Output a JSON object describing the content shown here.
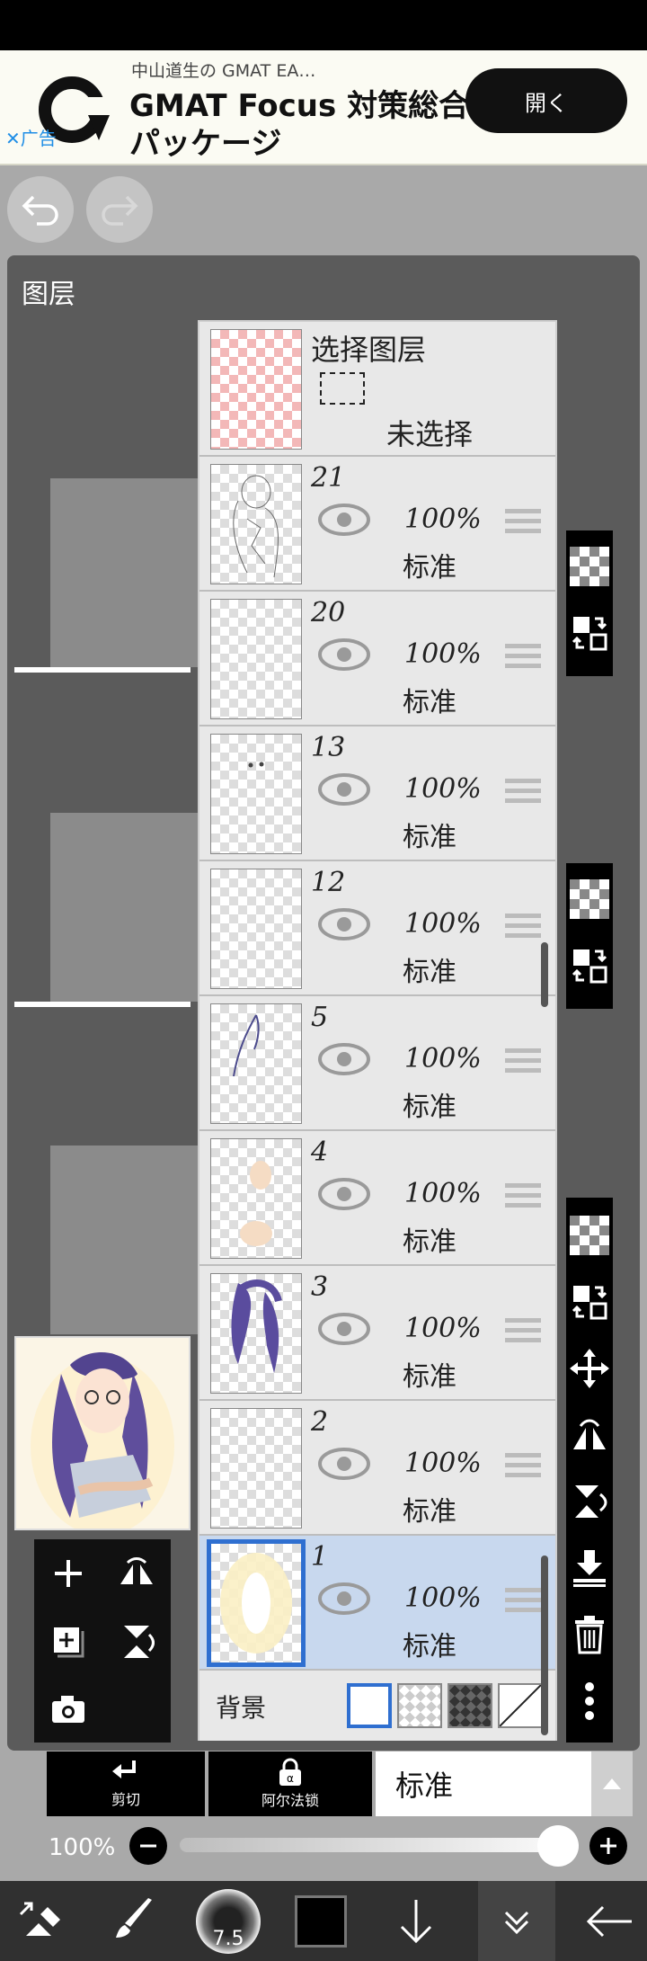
{
  "ad": {
    "small_text": "中山道生の GMAT EA…",
    "title_line1": "GMAT Focus 対策総合",
    "title_line2": "パッケージ",
    "open_label": "開く",
    "ad_tag": "✕广告"
  },
  "panel": {
    "title": "图层"
  },
  "select_layer": {
    "title": "选择图层",
    "status": "未选择"
  },
  "layers": [
    {
      "number": "21",
      "opacity": "100%",
      "blend": "标准"
    },
    {
      "number": "20",
      "opacity": "100%",
      "blend": "标准"
    },
    {
      "number": "13",
      "opacity": "100%",
      "blend": "标准"
    },
    {
      "number": "12",
      "opacity": "100%",
      "blend": "标准"
    },
    {
      "number": "5",
      "opacity": "100%",
      "blend": "标准"
    },
    {
      "number": "4",
      "opacity": "100%",
      "blend": "标准"
    },
    {
      "number": "3",
      "opacity": "100%",
      "blend": "标准"
    },
    {
      "number": "2",
      "opacity": "100%",
      "blend": "标准"
    },
    {
      "number": "1",
      "opacity": "100%",
      "blend": "标准",
      "selected": true
    }
  ],
  "background_row": {
    "label": "背景"
  },
  "bottom_tabs": {
    "clip_label": "剪切",
    "alpha_lock_label": "阿尔法锁",
    "blend_mode": "标准"
  },
  "opacity_control": {
    "label": "100%",
    "value": 1.0
  },
  "brush": {
    "size": "7.5"
  },
  "colors": {
    "selection_blue": "#2f6fd0",
    "selected_row": "#c8d8ee",
    "panel_bg": "#5b5b5b"
  }
}
